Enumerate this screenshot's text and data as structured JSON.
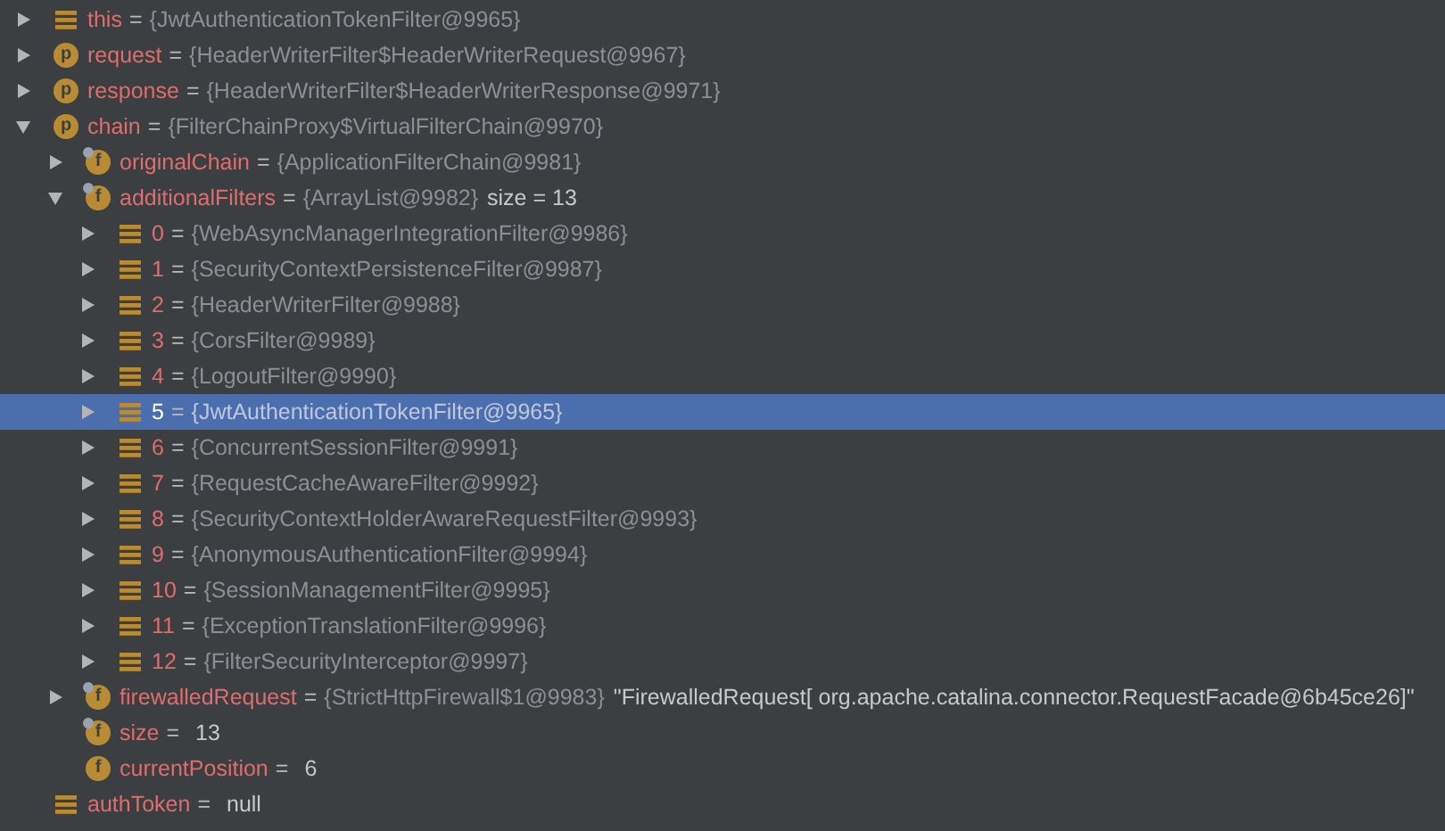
{
  "variables": [
    {
      "kind": "object",
      "name": "this",
      "sep": "=",
      "value": "{JwtAuthenticationTokenFilter@9965}",
      "expanded": false,
      "selected": false
    },
    {
      "kind": "param",
      "badge": "p",
      "name": "request",
      "sep": "=",
      "value": "{HeaderWriterFilter$HeaderWriterRequest@9967}",
      "expanded": false,
      "selected": false
    },
    {
      "kind": "param",
      "badge": "p",
      "name": "response",
      "sep": "=",
      "value": "{HeaderWriterFilter$HeaderWriterResponse@9971}",
      "expanded": false,
      "selected": false
    },
    {
      "kind": "param",
      "badge": "p",
      "name": "chain",
      "sep": "=",
      "value": "{FilterChainProxy$VirtualFilterChain@9970}",
      "expanded": true,
      "selected": false,
      "children": [
        {
          "kind": "field",
          "badge": "f",
          "final": true,
          "name": "originalChain",
          "sep": "=",
          "value": "{ApplicationFilterChain@9981}",
          "expanded": false,
          "selected": false
        },
        {
          "kind": "field",
          "badge": "f",
          "final": true,
          "name": "additionalFilters",
          "sep": "=",
          "value": "{ArrayList@9982}",
          "text": "size = 13",
          "expanded": true,
          "selected": false,
          "children": [
            {
              "kind": "object",
              "name": "0",
              "sep": "=",
              "value": "{WebAsyncManagerIntegrationFilter@9986}",
              "expanded": false,
              "selected": false
            },
            {
              "kind": "object",
              "name": "1",
              "sep": "=",
              "value": "{SecurityContextPersistenceFilter@9987}",
              "expanded": false,
              "selected": false
            },
            {
              "kind": "object",
              "name": "2",
              "sep": "=",
              "value": "{HeaderWriterFilter@9988}",
              "expanded": false,
              "selected": false
            },
            {
              "kind": "object",
              "name": "3",
              "sep": "=",
              "value": "{CorsFilter@9989}",
              "expanded": false,
              "selected": false
            },
            {
              "kind": "object",
              "name": "4",
              "sep": "=",
              "value": "{LogoutFilter@9990}",
              "expanded": false,
              "selected": false
            },
            {
              "kind": "object",
              "name": "5",
              "sep": "=",
              "value": "{JwtAuthenticationTokenFilter@9965}",
              "expanded": false,
              "selected": true
            },
            {
              "kind": "object",
              "name": "6",
              "sep": "=",
              "value": "{ConcurrentSessionFilter@9991}",
              "expanded": false,
              "selected": false
            },
            {
              "kind": "object",
              "name": "7",
              "sep": "=",
              "value": "{RequestCacheAwareFilter@9992}",
              "expanded": false,
              "selected": false
            },
            {
              "kind": "object",
              "name": "8",
              "sep": "=",
              "value": "{SecurityContextHolderAwareRequestFilter@9993}",
              "expanded": false,
              "selected": false
            },
            {
              "kind": "object",
              "name": "9",
              "sep": "=",
              "value": "{AnonymousAuthenticationFilter@9994}",
              "expanded": false,
              "selected": false
            },
            {
              "kind": "object",
              "name": "10",
              "sep": "=",
              "value": "{SessionManagementFilter@9995}",
              "expanded": false,
              "selected": false
            },
            {
              "kind": "object",
              "name": "11",
              "sep": "=",
              "value": "{ExceptionTranslationFilter@9996}",
              "expanded": false,
              "selected": false
            },
            {
              "kind": "object",
              "name": "12",
              "sep": "=",
              "value": "{FilterSecurityInterceptor@9997}",
              "expanded": false,
              "selected": false
            }
          ]
        },
        {
          "kind": "field",
          "badge": "f",
          "final": true,
          "name": "firewalledRequest",
          "sep": "=",
          "value": "{StrictHttpFirewall$1@9983}",
          "text": "\"FirewalledRequest[ org.apache.catalina.connector.RequestFacade@6b45ce26]\"",
          "expanded": false,
          "selected": false
        },
        {
          "kind": "field",
          "badge": "f",
          "final": true,
          "name": "size",
          "sep": "=",
          "text": "13",
          "selected": false
        },
        {
          "kind": "field",
          "badge": "f",
          "final": false,
          "name": "currentPosition",
          "sep": "=",
          "text": "6",
          "selected": false
        }
      ]
    },
    {
      "kind": "object",
      "name": "authToken",
      "sep": "=",
      "text": "null",
      "selected": false
    }
  ]
}
